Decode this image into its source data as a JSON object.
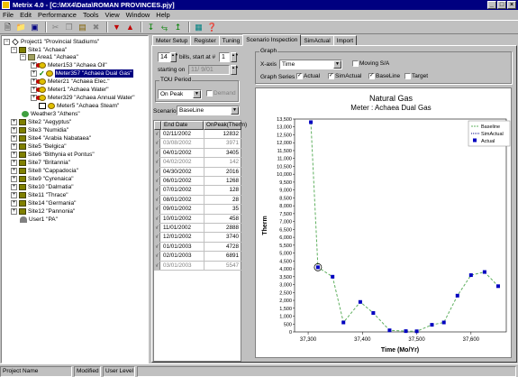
{
  "window": {
    "title": "Metrix 4.0 - [C:\\MX4\\Data\\ROMAN PROVINCES.pjy]",
    "controls": [
      "_",
      "□",
      "×"
    ]
  },
  "menu": [
    "File",
    "Edit",
    "Performance",
    "Tools",
    "View",
    "Window",
    "Help"
  ],
  "tree": {
    "project": "Project1 \"Provincial Stadiums\"",
    "site1": "Site1 \"Achaea\"",
    "area1": "Area1 \"Achaea\"",
    "meters": [
      "Meter153 \"Achaea Oil\"",
      "Meter357 \"Achaea Dual Gas\"",
      "Meter21 \"Achaea Elec.\"",
      "Meter1 \"Achaea Water\"",
      "Meter329 \"Achaea Annual Water\"",
      "Meter5 \"Achaea Steam\""
    ],
    "weather": "Weather3 \"Athens\"",
    "sites": [
      "Site2 \"Aegyptus\"",
      "Site3 \"Numidia\"",
      "Site4 \"Arabia Nabataea\"",
      "Site5 \"Belgica\"",
      "Site6 \"Bithynia et Pontus\"",
      "Site7 \"Britannia\"",
      "Site8 \"Cappadocia\"",
      "Site9 \"Cyrenaica\"",
      "Site10 \"Dalmatia\"",
      "Site11 \"Thrace\"",
      "Site14 \"Germania\"",
      "Site12 \"Pannonia\""
    ],
    "user": "User1 \"PA\""
  },
  "tabs": [
    "Meter Setup",
    "Register",
    "Tuning",
    "Scenario Inspection",
    "SimActual",
    "Import"
  ],
  "controls": {
    "bills_count": "14",
    "bills_label": "bills, start at #",
    "start_num": "1",
    "starting_on_label": "starting on",
    "starting_on_value": "11/ 9/01",
    "tou_label": "TOU Period",
    "tou_value": "On Peak",
    "demand_label": "Demand",
    "scenario_label": "Scenario",
    "scenario_value": "BaseLine"
  },
  "graph": {
    "group_label": "Graph",
    "xaxis_label": "X-axis",
    "xaxis_value": "Time",
    "moving_label": "Moving S/A",
    "series_label": "Graph Series",
    "actual_label": "Actual",
    "simactual_label": "SimActual",
    "baseline_label": "BaseLine",
    "target_label": "Target"
  },
  "table": {
    "headers": [
      "End Date",
      "OnPeak(Therm)"
    ],
    "rows": [
      {
        "date": "02/11/2002",
        "value": "12832"
      },
      {
        "date": "03/08/2002",
        "value": "3971"
      },
      {
        "date": "04/01/2002",
        "value": "3405"
      },
      {
        "date": "04/02/2002",
        "value": "142"
      },
      {
        "date": "04/30/2002",
        "value": "2016"
      },
      {
        "date": "06/01/2002",
        "value": "1268"
      },
      {
        "date": "07/01/2002",
        "value": "128"
      },
      {
        "date": "08/01/2002",
        "value": "28"
      },
      {
        "date": "09/01/2002",
        "value": "35"
      },
      {
        "date": "10/01/2002",
        "value": "458"
      },
      {
        "date": "11/01/2002",
        "value": "2888"
      },
      {
        "date": "12/01/2002",
        "value": "3740"
      },
      {
        "date": "01/01/2003",
        "value": "4728"
      },
      {
        "date": "02/01/2003",
        "value": "6891"
      },
      {
        "date": "03/01/2003",
        "value": "5547"
      }
    ]
  },
  "chart_data": {
    "type": "line",
    "title": "Natural Gas",
    "subtitle": "Meter : Achaea Dual Gas",
    "xlabel": "Time (Mo/Yr)",
    "ylabel": "Therm",
    "xlim": [
      37275,
      37665
    ],
    "ylim": [
      0,
      13500
    ],
    "xticks": [
      37300,
      37400,
      37500,
      37600
    ],
    "xtick_labels": [
      "37,300",
      "37,400",
      "37,500",
      "37,600"
    ],
    "yticks": [
      0,
      500,
      1000,
      1500,
      2000,
      2500,
      3000,
      3500,
      4000,
      4500,
      5000,
      5500,
      6000,
      6500,
      7000,
      7500,
      8000,
      8500,
      9000,
      9500,
      10000,
      10500,
      11000,
      11500,
      12000,
      12500,
      13000,
      13500
    ],
    "ytick_labels": [
      "0",
      "500",
      "1,000",
      "1,500",
      "2,000",
      "2,500",
      "3,000",
      "3,500",
      "4,000",
      "4,500",
      "5,000",
      "5,500",
      "6,000",
      "6,500",
      "7,000",
      "7,500",
      "8,000",
      "8,500",
      "9,000",
      "9,500",
      "10,000",
      "10,500",
      "11,000",
      "11,500",
      "12,000",
      "12,500",
      "13,000",
      "13,500"
    ],
    "legend": [
      "Baseline",
      "SimActual",
      "Actual"
    ],
    "legend_position": "top-right",
    "colors": {
      "baseline": "#60b060",
      "simactual": "#000080",
      "actual": "#0000c0"
    },
    "series": [
      {
        "name": "Actual",
        "x": [
          37305,
          37318,
          37345,
          37365,
          37396,
          37420,
          37450,
          37480,
          37500,
          37528,
          37550,
          37575,
          37600,
          37625,
          37650
        ],
        "y": [
          13300,
          4100,
          3500,
          600,
          1900,
          1200,
          100,
          50,
          40,
          450,
          600,
          2300,
          3600,
          3800,
          2900
        ]
      },
      {
        "name": "Baseline",
        "x": [
          37305,
          37318,
          37345,
          37365,
          37396,
          37420,
          37450,
          37480,
          37500,
          37528,
          37550,
          37575,
          37600,
          37625,
          37650
        ],
        "y": [
          13300,
          4100,
          3500,
          600,
          1900,
          1200,
          100,
          50,
          40,
          450,
          600,
          2300,
          3600,
          3800,
          2900
        ]
      }
    ],
    "highlight": {
      "x": 37318,
      "y": 4100
    }
  },
  "status": [
    "Project Name",
    "Modified",
    "User Level"
  ]
}
